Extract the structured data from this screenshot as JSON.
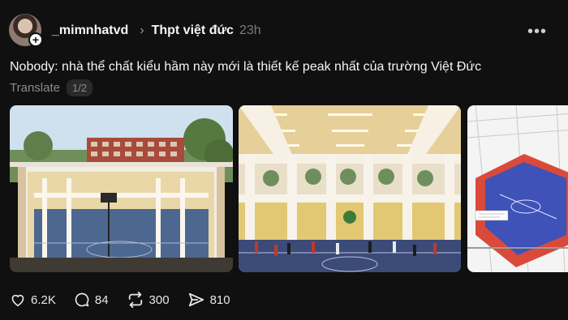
{
  "post": {
    "username": "_mimnhatvd",
    "topic": "Thpt việt đức",
    "time": "23h",
    "text": "Nobody: nhà thể chất kiểu hầm này mới là thiết kế peak nhất của trường Việt Đức",
    "translate_label": "Translate",
    "pager": "1/2"
  },
  "actions": {
    "likes": "6.2K",
    "replies": "84",
    "reposts": "300",
    "shares": "810"
  },
  "icons": [
    "plus-icon",
    "chevron-right-icon",
    "more-icon",
    "heart-icon",
    "comment-icon",
    "repost-icon",
    "share-icon"
  ],
  "colors": {
    "background": "#101010",
    "text": "#f3f5f7",
    "muted": "#7a7a7a"
  }
}
